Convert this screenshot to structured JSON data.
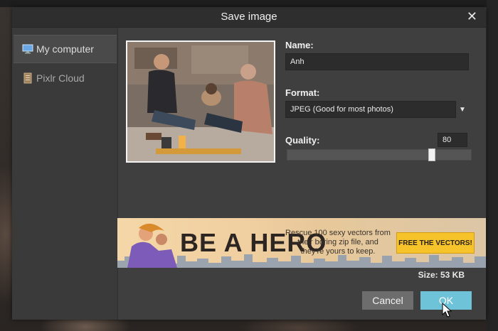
{
  "dialog": {
    "title": "Save image",
    "close_glyph": "✕"
  },
  "sidebar": {
    "items": [
      {
        "label": "My computer",
        "icon": "monitor-icon",
        "active": true
      },
      {
        "label": "Pixlr Cloud",
        "icon": "cloud-storage-icon",
        "active": false
      }
    ]
  },
  "form": {
    "name_label": "Name:",
    "name_value": "Anh",
    "format_label": "Format:",
    "format_value": "JPEG (Good for most photos)",
    "quality_label": "Quality:",
    "quality_value": "80",
    "quality_level": 0.8
  },
  "ad": {
    "headline": "BE A HERO",
    "copy": "Rescue 100 sexy vectors from their boring zip file, and they're yours to keep.",
    "cta": "FREE THE VECTORS!"
  },
  "size_text": "Size: 53 KB",
  "buttons": {
    "cancel": "Cancel",
    "ok": "OK"
  },
  "colors": {
    "ok_accent": "#6fc3d9",
    "cta_yellow": "#f7c32a"
  }
}
